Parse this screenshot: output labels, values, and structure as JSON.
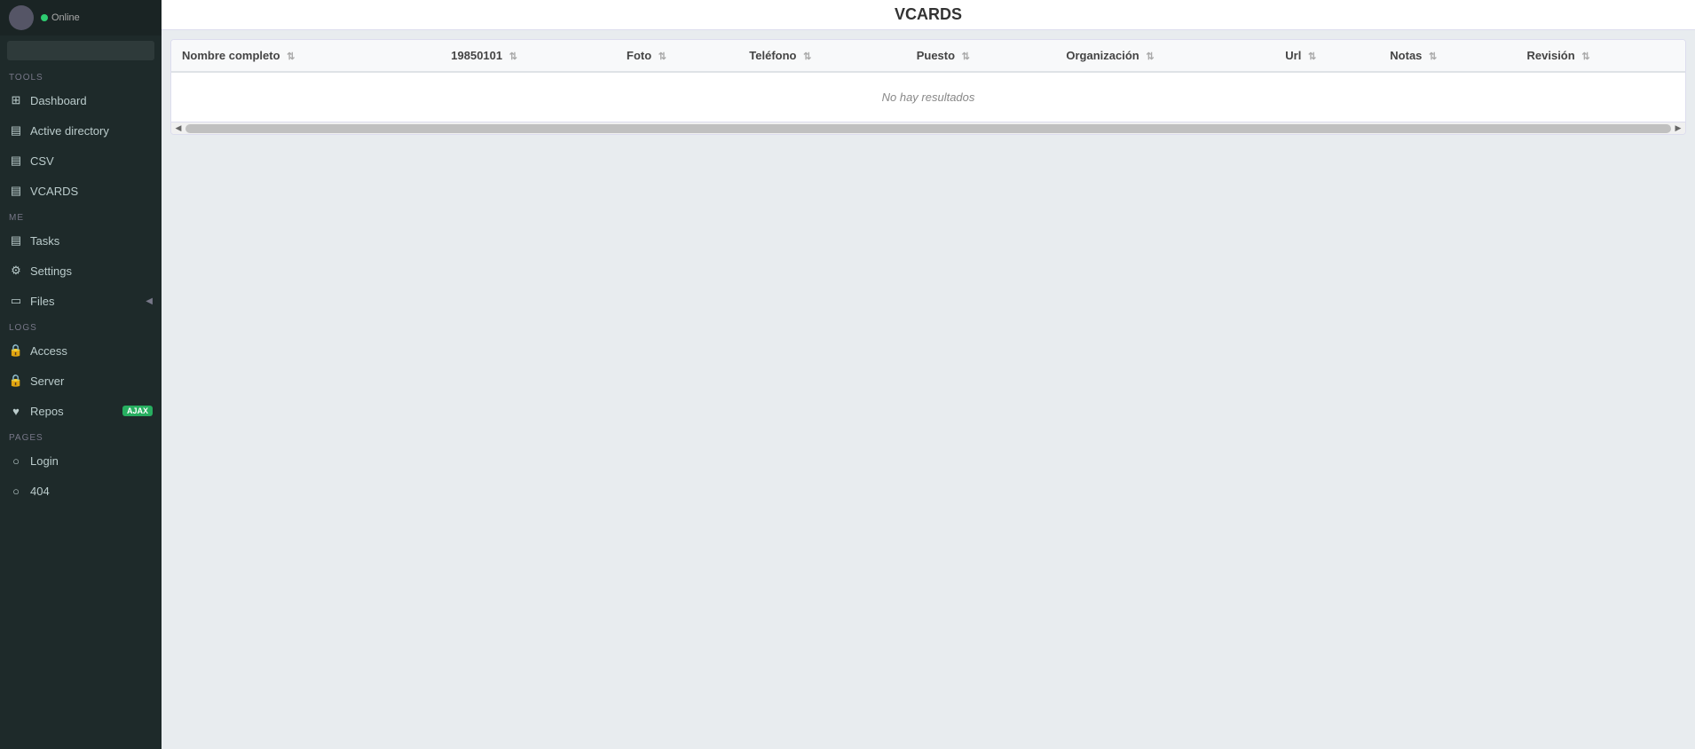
{
  "sidebar": {
    "user": {
      "status": "Online"
    },
    "search": {
      "placeholder": ""
    },
    "sections": {
      "tools": "TOOLS",
      "me": "ME",
      "logs": "LOGS",
      "pages": "PAGES"
    },
    "nav": {
      "dashboard": "Dashboard",
      "active_directory": "Active directory",
      "csv": "CSV",
      "vcards": "VCARDS",
      "tasks": "Tasks",
      "settings": "Settings",
      "files": "Files",
      "access": "Access",
      "server": "Server",
      "repos": "Repos",
      "login": "Login",
      "not_found": "404"
    },
    "badges": {
      "repos": "AJAX"
    }
  },
  "page": {
    "title": "VCARDS"
  },
  "table": {
    "columns": [
      "Nombre completo",
      "19850101",
      "Foto",
      "Teléfono",
      "Puesto",
      "Organización",
      "Url",
      "Notas",
      "Revisión"
    ],
    "no_results": "No hay resultados"
  }
}
